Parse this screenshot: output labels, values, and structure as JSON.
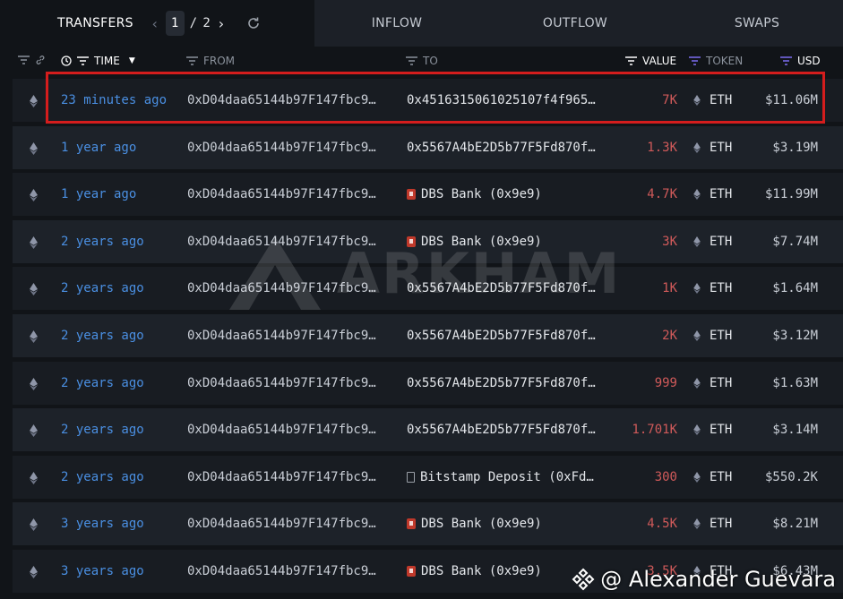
{
  "tabs": {
    "transfers_label": "TRANSFERS",
    "page_current": "1",
    "page_sep": "/",
    "page_total": "2",
    "inflow_label": "INFLOW",
    "outflow_label": "OUTFLOW",
    "swaps_label": "SWAPS"
  },
  "columns": {
    "time": "TIME",
    "from": "FROM",
    "to": "TO",
    "value": "VALUE",
    "token": "TOKEN",
    "usd": "USD"
  },
  "rows": [
    {
      "time": "23 minutes ago",
      "from": "0xD04daa65144b97F147fbc9…",
      "to": "0x4516315061025107f4f965…",
      "to_icon": "",
      "value": "7K",
      "token": "ETH",
      "usd": "$11.06M"
    },
    {
      "time": "1 year ago",
      "from": "0xD04daa65144b97F147fbc9…",
      "to": "0x5567A4bE2D5b77F5Fd870f…",
      "to_icon": "",
      "value": "1.3K",
      "token": "ETH",
      "usd": "$3.19M"
    },
    {
      "time": "1 year ago",
      "from": "0xD04daa65144b97F147fbc9…",
      "to": "DBS Bank (0x9e9)",
      "to_icon": "bank",
      "value": "4.7K",
      "token": "ETH",
      "usd": "$11.99M"
    },
    {
      "time": "2 years ago",
      "from": "0xD04daa65144b97F147fbc9…",
      "to": "DBS Bank (0x9e9)",
      "to_icon": "bank",
      "value": "3K",
      "token": "ETH",
      "usd": "$7.74M"
    },
    {
      "time": "2 years ago",
      "from": "0xD04daa65144b97F147fbc9…",
      "to": "0x5567A4bE2D5b77F5Fd870f…",
      "to_icon": "",
      "value": "1K",
      "token": "ETH",
      "usd": "$1.64M"
    },
    {
      "time": "2 years ago",
      "from": "0xD04daa65144b97F147fbc9…",
      "to": "0x5567A4bE2D5b77F5Fd870f…",
      "to_icon": "",
      "value": "2K",
      "token": "ETH",
      "usd": "$3.12M"
    },
    {
      "time": "2 years ago",
      "from": "0xD04daa65144b97F147fbc9…",
      "to": "0x5567A4bE2D5b77F5Fd870f…",
      "to_icon": "",
      "value": "999",
      "token": "ETH",
      "usd": "$1.63M"
    },
    {
      "time": "2 years ago",
      "from": "0xD04daa65144b97F147fbc9…",
      "to": "0x5567A4bE2D5b77F5Fd870f…",
      "to_icon": "",
      "value": "1.701K",
      "token": "ETH",
      "usd": "$3.14M"
    },
    {
      "time": "2 years ago",
      "from": "0xD04daa65144b97F147fbc9…",
      "to": "Bitstamp Deposit (0xFd…",
      "to_icon": "doc",
      "value": "300",
      "token": "ETH",
      "usd": "$550.2K"
    },
    {
      "time": "3 years ago",
      "from": "0xD04daa65144b97F147fbc9…",
      "to": "DBS Bank (0x9e9)",
      "to_icon": "bank",
      "value": "4.5K",
      "token": "ETH",
      "usd": "$8.21M"
    },
    {
      "time": "3 years ago",
      "from": "0xD04daa65144b97F147fbc9…",
      "to": "DBS Bank (0x9e9)",
      "to_icon": "bank",
      "value": "3.5K",
      "token": "ETH",
      "usd": "$6.43M"
    }
  ],
  "watermark": "ARKHAM",
  "credit": "@ Alexander Guevara",
  "colors": {
    "background": "#111418",
    "row": "#181c22",
    "row_alt": "#1d2229",
    "time_link": "#4a8fe2",
    "value_out": "#d05a5a",
    "highlight": "#d41d1d",
    "token_filter": "#7c6cf0"
  },
  "icons": [
    "chevron-left-icon",
    "chevron-right-icon",
    "refresh-icon",
    "filter-icon",
    "link-icon",
    "clock-icon",
    "sort-down-icon",
    "eth-icon",
    "bank-icon",
    "document-icon",
    "binance-square-icon"
  ]
}
